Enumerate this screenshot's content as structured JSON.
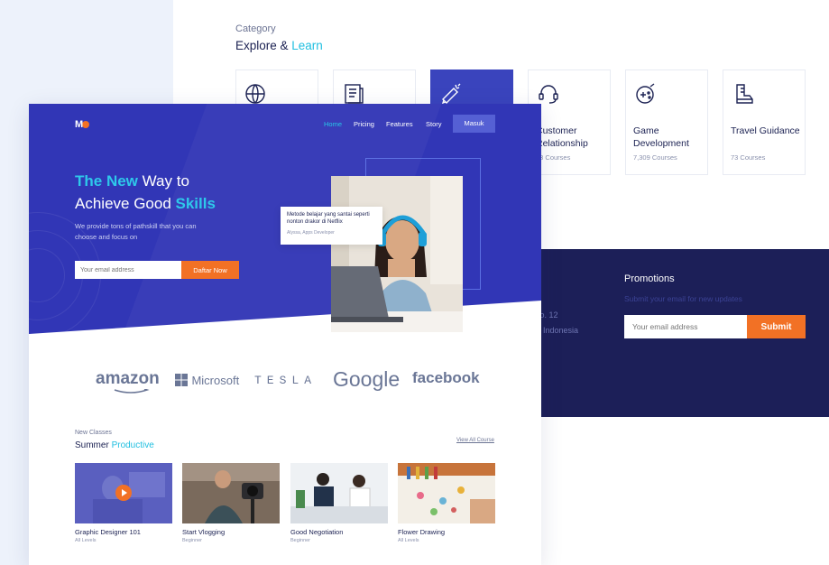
{
  "category": {
    "label": "Category",
    "title_main": "Explore & ",
    "title_highlight": "Learn",
    "cards": [
      {
        "name": "",
        "count": "",
        "icon": "globe-icon"
      },
      {
        "name": "",
        "count": "",
        "icon": "document-icon"
      },
      {
        "name": "",
        "count": "",
        "icon": "megaphone-icon"
      },
      {
        "name": "Customer Relationship",
        "count": "53 Courses",
        "icon": "headset-icon"
      },
      {
        "name": "Game Development",
        "count": "7,309 Courses",
        "icon": "gamepad-icon"
      },
      {
        "name": "Travel Guidance",
        "count": "73 Courses",
        "icon": "boot-icon"
      }
    ]
  },
  "footer": {
    "address_line1": "No. 12",
    "address_line2": "n, Indonesia",
    "promo_title": "Promotions",
    "promo_sub": "Submit your email for new updates",
    "promo_placeholder": "Your email address",
    "promo_button": "Submit"
  },
  "landing": {
    "logo": "M",
    "nav": [
      "Home",
      "Pricing",
      "Features",
      "Story"
    ],
    "login_button": "Masuk",
    "headline_cyan1": "The New",
    "headline_white1": " Way to",
    "headline_white2": "Achieve Good ",
    "headline_cyan2": "Skills",
    "subtext": "We provide tons of pathskill that you can choose and focus on",
    "email_placeholder": "Your email address",
    "cta_button": "Daftar Now",
    "testimonial_text": "Metode belajar yang santai seperti nonton drakor di Netflix",
    "testimonial_author": "Alyssa, Apps Developer",
    "brands": [
      "amazon",
      "Microsoft",
      "TESLA",
      "Google",
      "facebook"
    ],
    "new_classes_label": "New Classes",
    "new_classes_title": "Summer ",
    "new_classes_highlight": "Productive",
    "view_all": "View All Course",
    "courses": [
      {
        "title": "Graphic Designer 101",
        "level": "All Levels"
      },
      {
        "title": "Start Vlogging",
        "level": "Beginner"
      },
      {
        "title": "Good Negotiation",
        "level": "Beginner"
      },
      {
        "title": "Flower Drawing",
        "level": "All Levels"
      }
    ]
  },
  "colors": {
    "primary": "#3136b6",
    "accent": "#f27125",
    "cyan": "#2ec8ea",
    "navy": "#1c1f58"
  }
}
